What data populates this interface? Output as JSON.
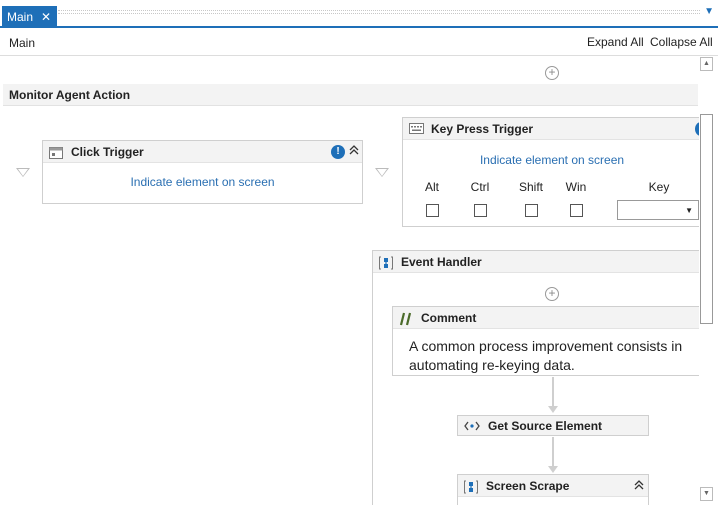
{
  "tabs": [
    {
      "label": "Main",
      "close": "✕",
      "active": true
    }
  ],
  "tab_overflow_glyph": "▼",
  "breadcrumb": "Main",
  "header": {
    "expand_all": "Expand All",
    "collapse_all": "Collapse All"
  },
  "sequence": {
    "title": "Monitor Agent Action"
  },
  "click_trigger": {
    "title": "Click Trigger",
    "indicate": "Indicate element on screen",
    "warning_glyph": "!",
    "collapse_glyph": "⌃"
  },
  "key_press_trigger": {
    "title": "Key Press Trigger",
    "indicate": "Indicate element on screen",
    "modifiers": [
      "Alt",
      "Ctrl",
      "Shift",
      "Win"
    ],
    "key_label": "Key",
    "key_value": ""
  },
  "event_handler": {
    "title": "Event Handler"
  },
  "comment": {
    "title": "Comment",
    "text": "A common process improvement consists in automating re-keying data."
  },
  "get_source_element": {
    "title": "Get Source Element"
  },
  "screen_scrape": {
    "title": "Screen Scrape"
  },
  "colors": {
    "accent": "#1e6fb8",
    "link": "#2a6fb2",
    "header_bg": "#f3f3f3"
  }
}
